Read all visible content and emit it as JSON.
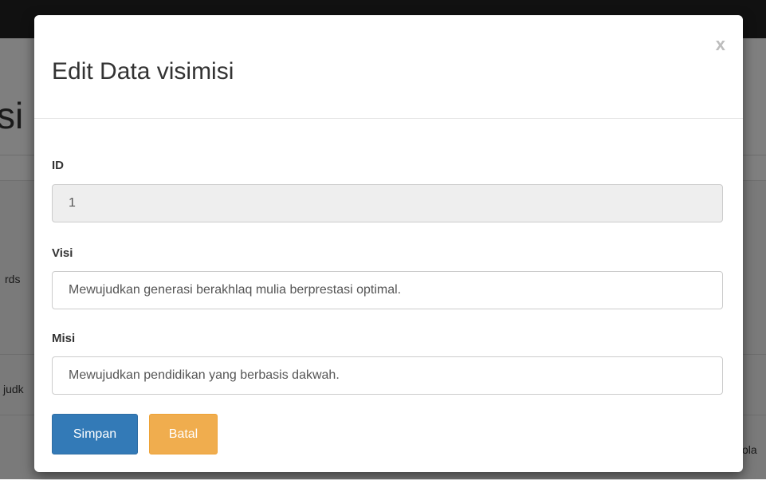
{
  "background": {
    "title_fragment": "si",
    "left_text_1": "rds",
    "left_text_2": "judk",
    "right_text": "kola"
  },
  "modal": {
    "title": "Edit Data visimisi",
    "close_label": "x",
    "fields": {
      "id": {
        "label": "ID",
        "value": "1"
      },
      "visi": {
        "label": "Visi",
        "value": "Mewujudkan generasi berakhlaq mulia berprestasi optimal."
      },
      "misi": {
        "label": "Misi",
        "value": "Mewujudkan pendidikan yang berbasis dakwah."
      }
    },
    "buttons": {
      "save": "Simpan",
      "cancel": "Batal"
    }
  },
  "colors": {
    "primary": "#337ab7",
    "warning": "#f0ad4e"
  }
}
